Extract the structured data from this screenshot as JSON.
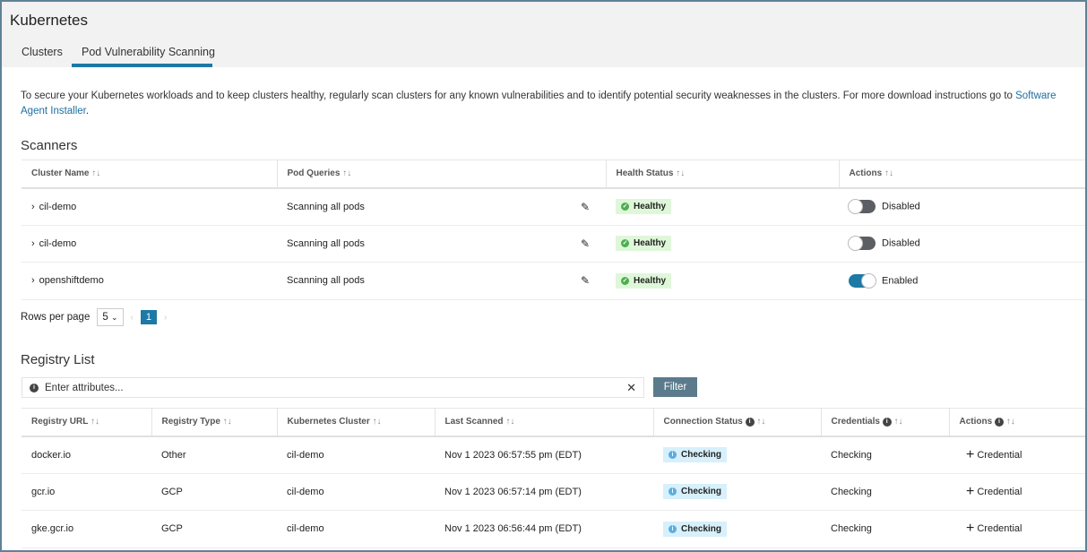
{
  "app": {
    "title": "Kubernetes",
    "tabs": [
      {
        "label": "Clusters"
      },
      {
        "label": "Pod Vulnerability Scanning"
      }
    ]
  },
  "intro": {
    "text": "To secure your Kubernetes workloads and to keep clusters healthy, regularly scan clusters for any known vulnerabilities and to identify potential security weaknesses in the clusters. For more download instructions go to ",
    "link": "Software Agent Installer",
    "end": "."
  },
  "scanners": {
    "title": "Scanners",
    "columns": [
      "Cluster Name",
      "Pod Queries",
      "Health Status",
      "Actions"
    ],
    "rows": [
      {
        "cluster": "cil-demo",
        "queries": "Scanning all pods",
        "health": "Healthy",
        "action": "Disabled",
        "enabled": false
      },
      {
        "cluster": "cil-demo",
        "queries": "Scanning all pods",
        "health": "Healthy",
        "action": "Disabled",
        "enabled": false
      },
      {
        "cluster": "openshiftdemo",
        "queries": "Scanning all pods",
        "health": "Healthy",
        "action": "Enabled",
        "enabled": true
      }
    ],
    "rows_per_page_label": "Rows per page",
    "rows_per_page": "5",
    "page": "1"
  },
  "registry": {
    "title": "Registry List",
    "filter_placeholder": "Enter attributes...",
    "filter_button": "Filter",
    "columns": [
      "Registry URL",
      "Registry Type",
      "Kubernetes Cluster",
      "Last Scanned",
      "Connection Status",
      "Credentials",
      "Actions"
    ],
    "rows": [
      {
        "url": "docker.io",
        "type": "Other",
        "cluster": "cil-demo",
        "scanned": "Nov 1 2023 06:57:55 pm (EDT)",
        "status": "Checking",
        "credentials": "Checking",
        "action": "Credential"
      },
      {
        "url": "gcr.io",
        "type": "GCP",
        "cluster": "cil-demo",
        "scanned": "Nov 1 2023 06:57:14 pm (EDT)",
        "status": "Checking",
        "credentials": "Checking",
        "action": "Credential"
      },
      {
        "url": "gke.gcr.io",
        "type": "GCP",
        "cluster": "cil-demo",
        "scanned": "Nov 1 2023 06:56:44 pm (EDT)",
        "status": "Checking",
        "credentials": "Checking",
        "action": "Credential"
      }
    ]
  },
  "colors": {
    "accent": "#1d79a6",
    "healthy_bg": "#dff7d9",
    "checking_bg": "#d7f0fb",
    "filter_button": "#5b7b8c"
  }
}
